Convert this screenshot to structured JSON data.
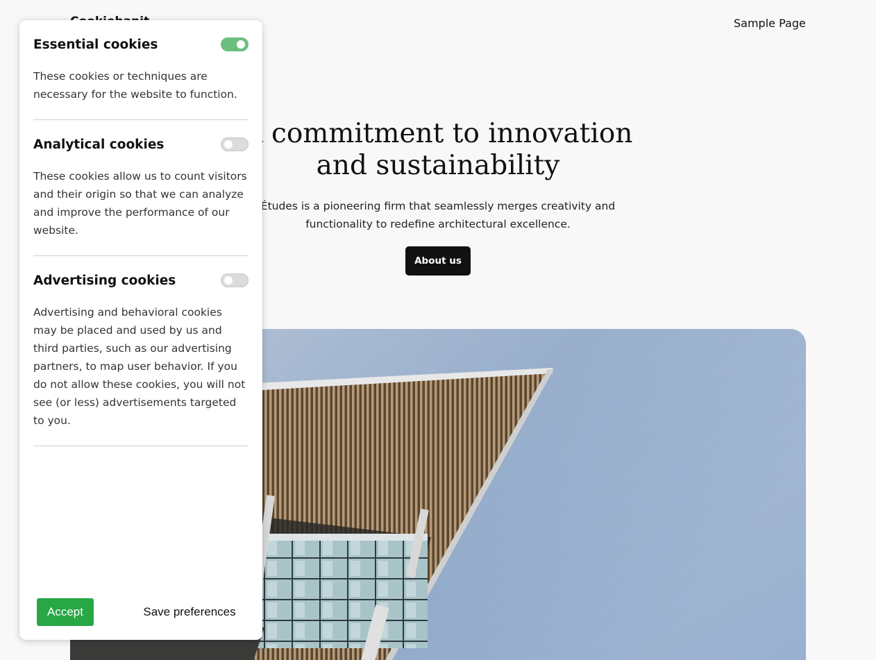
{
  "site": {
    "title": "Cookiebanit",
    "nav": {
      "sample_page": "Sample Page"
    }
  },
  "hero": {
    "heading_line1": "A commitment to innovation",
    "heading_line2": "and sustainability",
    "subtext_line1": "Études is a pioneering firm that seamlessly merges creativity and",
    "subtext_line2": "functionality to redefine architectural excellence.",
    "button_label": "About us",
    "image": "modern-building-roof-against-sky"
  },
  "cookie_panel": {
    "sections": [
      {
        "title": "Essential cookies",
        "enabled": true,
        "description": "These cookies or techniques are necessary for the website to function."
      },
      {
        "title": "Analytical cookies",
        "enabled": false,
        "description": "These cookies allow us to count visitors and their origin so that we can analyze and improve the performance of our website."
      },
      {
        "title": "Advertising cookies",
        "enabled": false,
        "description": "Advertising and behavioral cookies may be placed and used by us and third parties, such as our advertising partners, to map user behavior. If you do not allow these cookies, you will not see (or less) advertisements targeted to you."
      }
    ],
    "accept_label": "Accept",
    "save_label": "Save preferences"
  },
  "colors": {
    "accept": "#28a745",
    "toggle_on": "#6bbf7e",
    "toggle_off": "#dcdcdc",
    "primary_button": "#111111"
  }
}
